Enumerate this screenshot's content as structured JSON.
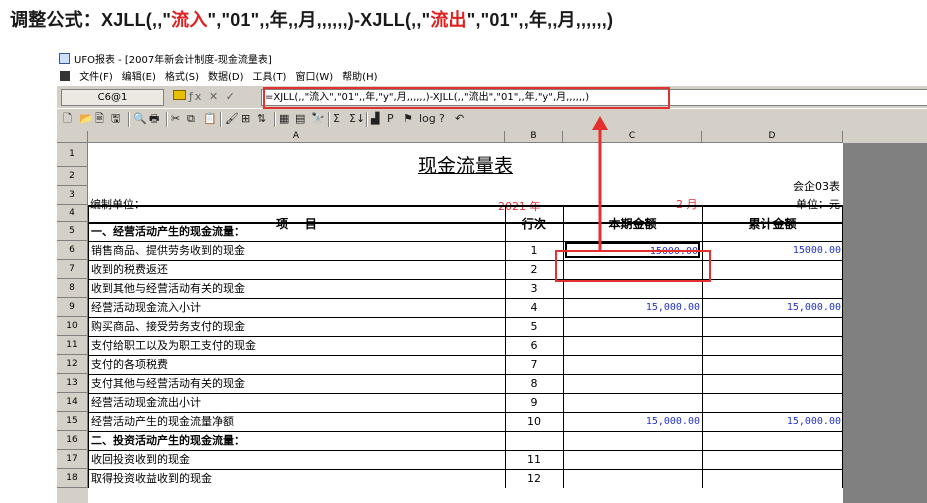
{
  "headline": {
    "prefix": "调整公式：XJLL(,,\"",
    "inflow": "流入",
    "middle": "\",\"01\",,年,,月,,,,,,)-XJLL(,,\"",
    "outflow": "流出",
    "suffix": "\",\"01\",,年,,月,,,,,,)"
  },
  "window": {
    "title": "UFO报表 - [2007年新会计制度-现金流量表]"
  },
  "menu": [
    "文件(F)",
    "编辑(E)",
    "格式(S)",
    "数据(D)",
    "工具(T)",
    "窗口(W)",
    "帮助(H)"
  ],
  "formula_bar": {
    "cell_ref": "C6@1",
    "formula": "=XJLL(,,\"流入\",\"01\",,年,\"y\",月,,,,,,)-XJLL(,,\"流出\",\"01\",,年,\"y\",月,,,,,,)"
  },
  "toolbar_icons": [
    "new-icon",
    "open-icon",
    "blank-icon",
    "save-icon",
    "preview-icon",
    "print-icon",
    "cut-icon",
    "copy-icon",
    "paste-icon",
    "format-painter-icon",
    "insert-icon",
    "sort-icon",
    "merge-icon",
    "grid-icon",
    "find-icon",
    "sum-icon",
    "sort-sum-icon",
    "chart-icon",
    "p-icon",
    "flag-icon",
    "log-icon",
    "help-icon",
    "undo-icon"
  ],
  "toolbar_glyphs": [
    "🗋",
    "📂",
    "🗎",
    "🖫",
    "🔍",
    "🖶",
    "✂",
    "⧉",
    "📋",
    "🖌",
    "⊞",
    "⇅",
    "▦",
    "▤",
    "🔭",
    "Σ",
    "Σ↓",
    "▟",
    "P",
    "⚑",
    "log",
    "?",
    "↶"
  ],
  "columns": [
    "A",
    "B",
    "C",
    "D"
  ],
  "sheet": {
    "title": "现金流量表",
    "code": "会企03表",
    "unit_label": "编制单位：",
    "year": "2021 年",
    "month": "2 月",
    "currency": "单位：元",
    "headers": [
      "项    目",
      "行次",
      "本期金额",
      "累计金额"
    ]
  },
  "rows": [
    {
      "n": "1"
    },
    {
      "n": "2"
    },
    {
      "n": "3"
    },
    {
      "n": "4"
    },
    {
      "n": "5",
      "item": "一、经营活动产生的现金流量：",
      "line": "",
      "current": "",
      "cumulative": "",
      "section": true
    },
    {
      "n": "6",
      "item": "销售商品、提供劳务收到的现金",
      "line": "1",
      "current": "15000.00",
      "cumulative": "15000.00"
    },
    {
      "n": "7",
      "item": "收到的税费返还",
      "line": "2",
      "current": "",
      "cumulative": ""
    },
    {
      "n": "8",
      "item": "收到其他与经营活动有关的现金",
      "line": "3",
      "current": "",
      "cumulative": ""
    },
    {
      "n": "9",
      "item": "经营活动现金流入小计",
      "line": "4",
      "current": "15,000.00",
      "cumulative": "15,000.00"
    },
    {
      "n": "10",
      "item": "购买商品、接受劳务支付的现金",
      "line": "5",
      "current": "",
      "cumulative": ""
    },
    {
      "n": "11",
      "item": "支付给职工以及为职工支付的现金",
      "line": "6",
      "current": "",
      "cumulative": ""
    },
    {
      "n": "12",
      "item": "支付的各项税费",
      "line": "7",
      "current": "",
      "cumulative": ""
    },
    {
      "n": "13",
      "item": "支付其他与经营活动有关的现金",
      "line": "8",
      "current": "",
      "cumulative": ""
    },
    {
      "n": "14",
      "item": "经营活动现金流出小计",
      "line": "9",
      "current": "",
      "cumulative": ""
    },
    {
      "n": "15",
      "item": "经营活动产生的现金流量净额",
      "line": "10",
      "current": "15,000.00",
      "cumulative": "15,000.00"
    },
    {
      "n": "16",
      "item": "二、投资活动产生的现金流量：",
      "line": "",
      "current": "",
      "cumulative": "",
      "section": true
    },
    {
      "n": "17",
      "item": "收回投资收到的现金",
      "line": "11",
      "current": "",
      "cumulative": ""
    },
    {
      "n": "18",
      "item": "取得投资收益收到的现金",
      "line": "12",
      "current": "",
      "cumulative": ""
    }
  ],
  "colors": {
    "highlight_red": "#e53030",
    "number_blue": "#2233cc",
    "chrome_grey": "#d4d0c8"
  }
}
